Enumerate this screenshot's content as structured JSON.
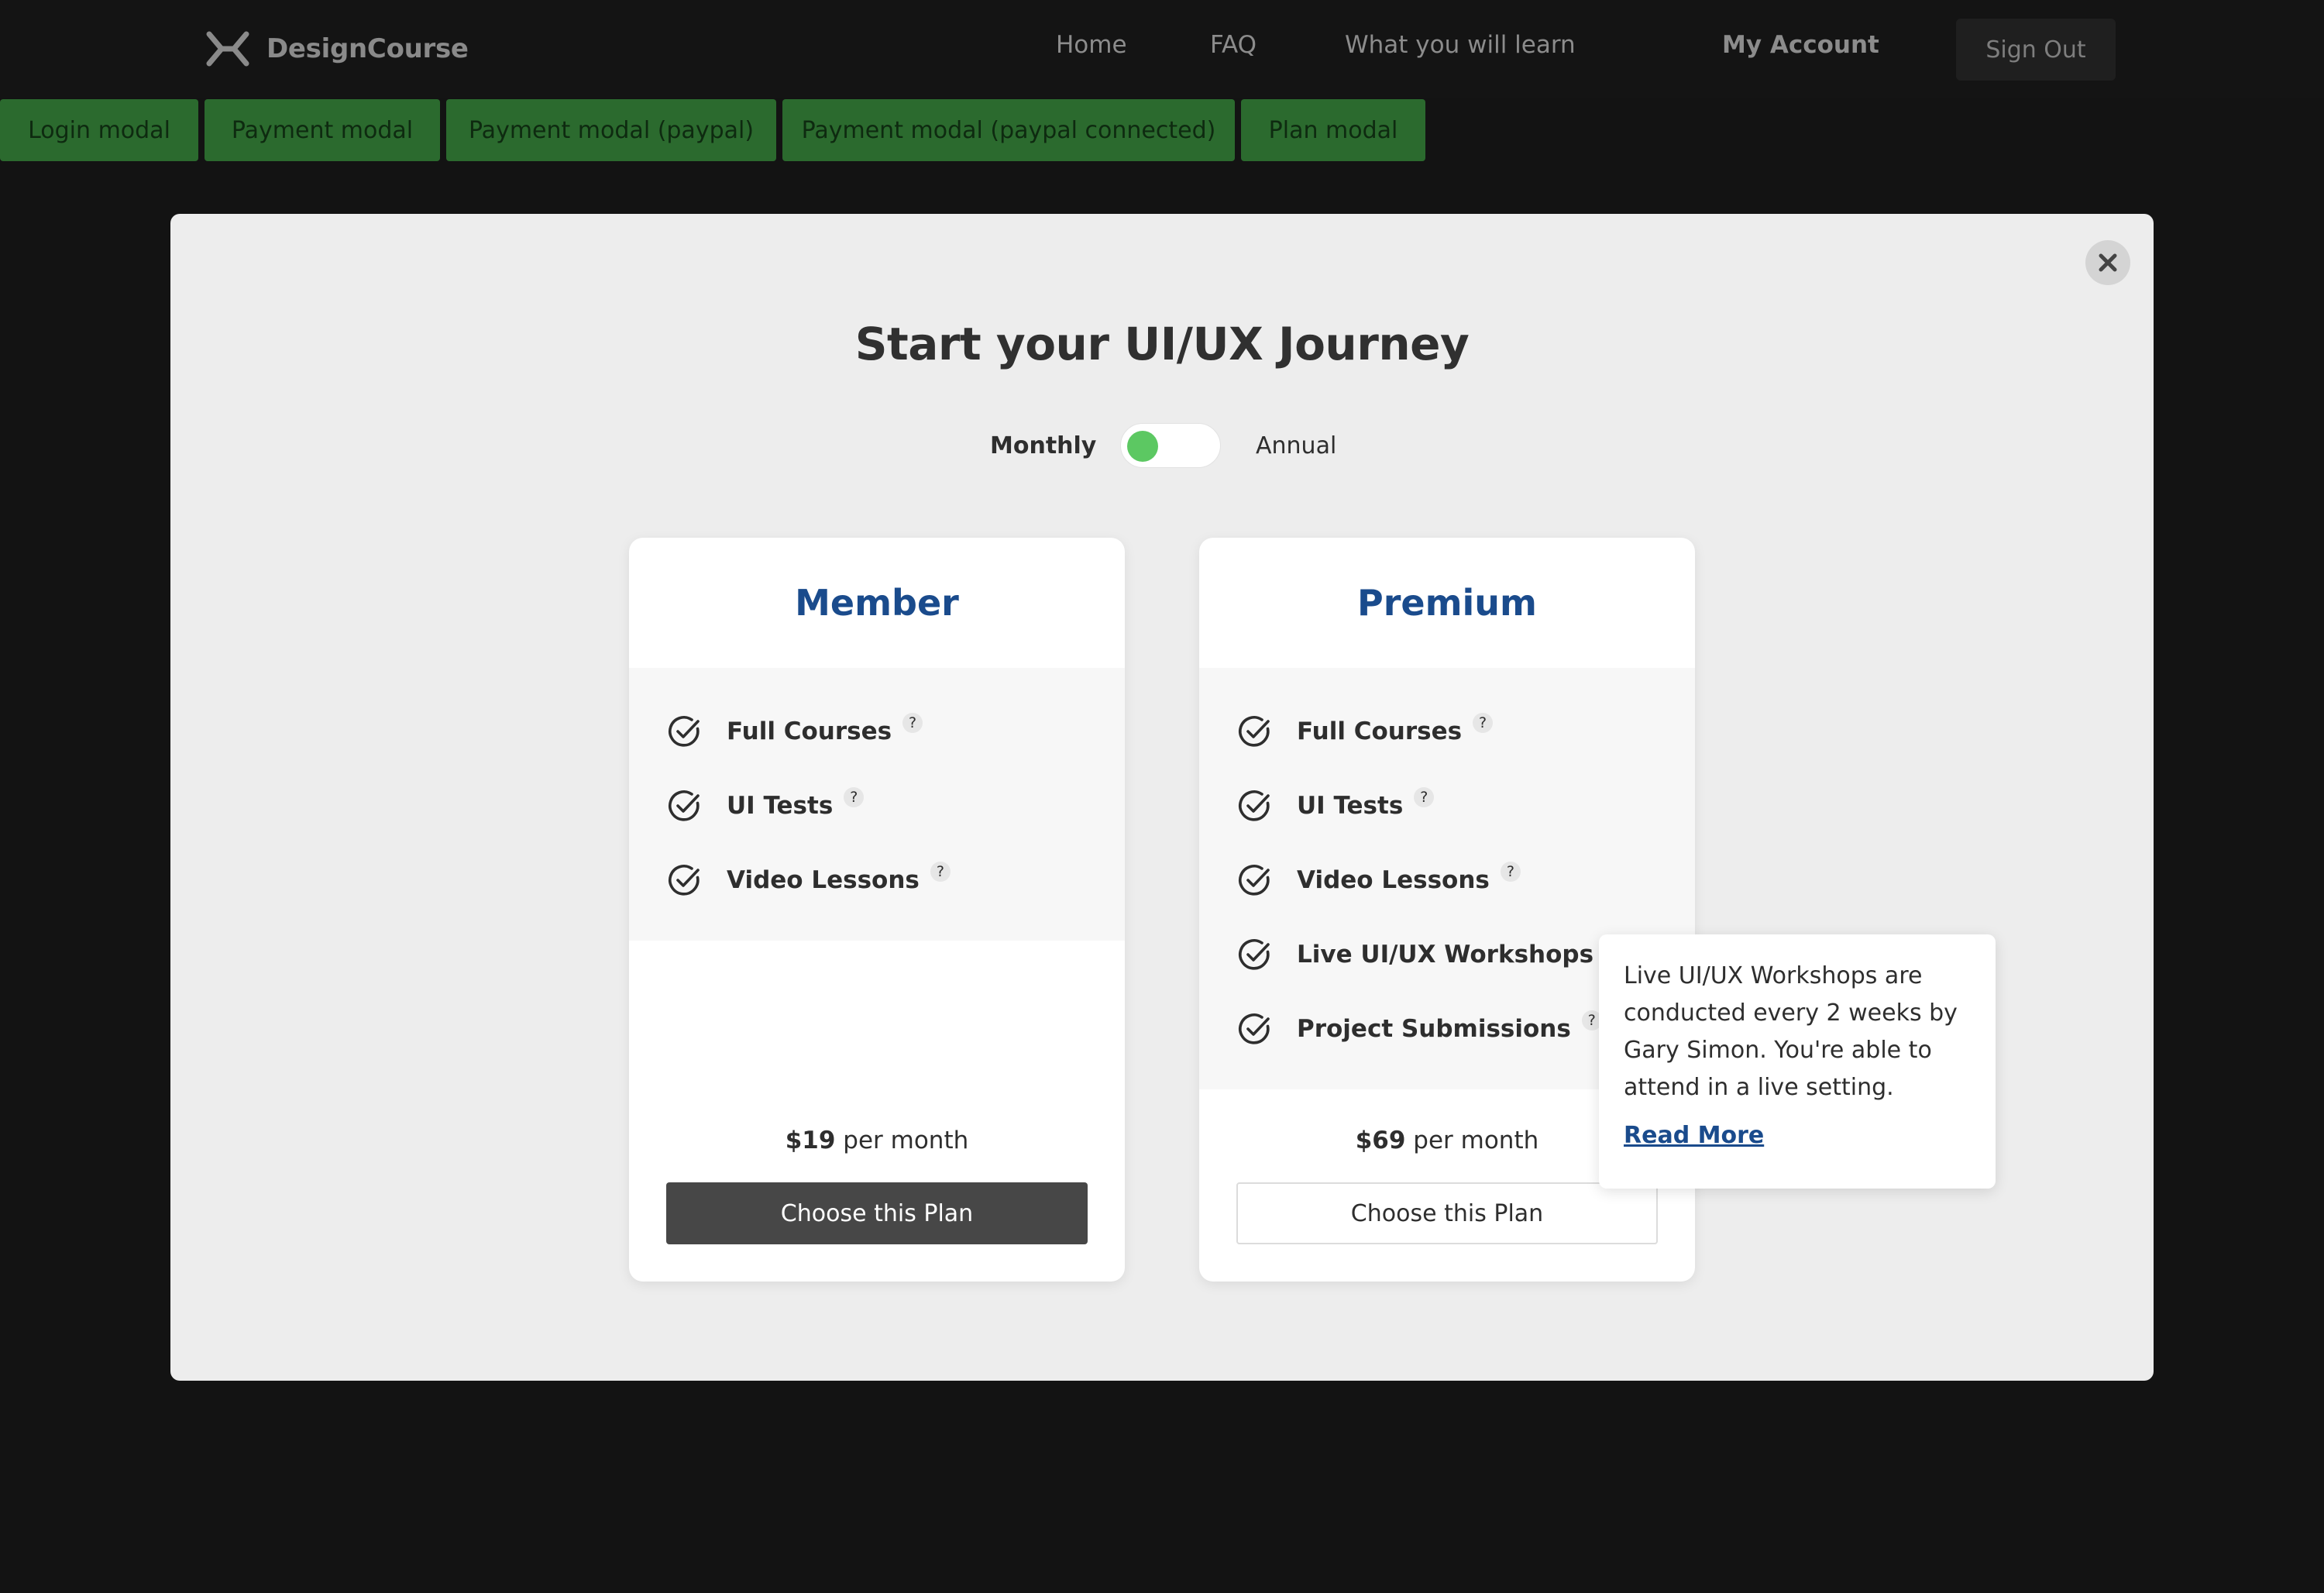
{
  "header": {
    "logo_text": "DesignCourse",
    "nav": [
      "Home",
      "FAQ",
      "What you will learn"
    ],
    "account_label": "My Account",
    "signout_label": "Sign Out"
  },
  "demo_buttons": [
    "Login modal",
    "Payment modal",
    "Payment modal (paypal)",
    "Payment modal (paypal connected)",
    "Plan modal"
  ],
  "modal": {
    "title": "Start your UI/UX Journey",
    "billing": {
      "monthly_label": "Monthly",
      "annual_label": "Annual",
      "selected": "Monthly"
    },
    "plans": [
      {
        "name": "Member",
        "features": [
          "Full Courses",
          "UI Tests",
          "Video Lessons"
        ],
        "price": "$19",
        "period": "per month",
        "cta": "Choose this Plan"
      },
      {
        "name": "Premium",
        "features": [
          "Full Courses",
          "UI Tests",
          "Video Lessons",
          "Live UI/UX Workshops",
          "Project Submissions"
        ],
        "price": "$69",
        "period": "per month",
        "cta": "Choose this Plan"
      }
    ],
    "help_glyph": "?",
    "tooltip": {
      "text": "Live UI/UX Workshops are conducted every 2 weeks by Gary Simon. You're able to attend in a live setting.",
      "link": "Read More"
    }
  },
  "colors": {
    "background": "#131313",
    "demo_button": "#2b6a2e",
    "plan_title": "#1a4b8c",
    "toggle_knob": "#5cc862",
    "dark_button": "#474747"
  },
  "icons": [
    "logo-mark-icon",
    "close-icon",
    "check-circle-icon",
    "help-icon"
  ]
}
